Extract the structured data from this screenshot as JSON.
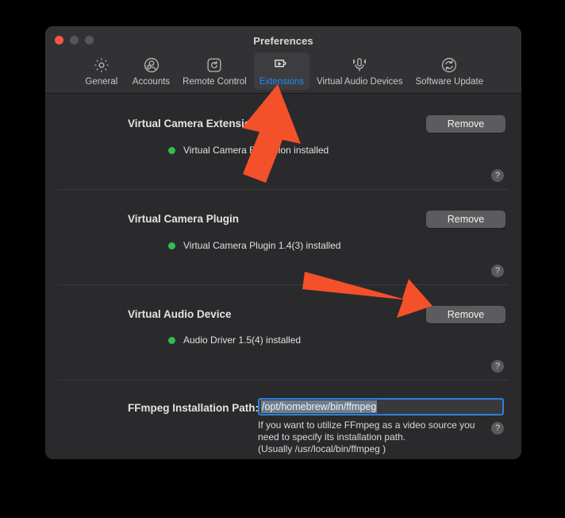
{
  "window": {
    "title": "Preferences",
    "traffic_lights": [
      "close",
      "minimize",
      "maximize"
    ]
  },
  "toolbar": {
    "items": [
      {
        "label": "General",
        "icon": "gear-icon",
        "active": false
      },
      {
        "label": "Accounts",
        "icon": "user-account-icon",
        "active": false
      },
      {
        "label": "Remote Control",
        "icon": "remote-control-icon",
        "active": false
      },
      {
        "label": "Extensions",
        "icon": "puzzle-play-icon",
        "active": true
      },
      {
        "label": "Virtual Audio Devices",
        "icon": "microphone-icon",
        "active": false
      },
      {
        "label": "Software Update",
        "icon": "refresh-circle-icon",
        "active": false
      }
    ]
  },
  "sections": [
    {
      "title": "Virtual Camera Extension",
      "status": "Virtual Camera Extension installed",
      "status_color": "#2fc04a",
      "button": "Remove",
      "help": "?"
    },
    {
      "title": "Virtual Camera Plugin",
      "status": "Virtual Camera Plugin 1.4(3) installed",
      "status_color": "#2fc04a",
      "button": "Remove",
      "help": "?"
    },
    {
      "title": "Virtual Audio Device",
      "status": "Audio Driver 1.5(4) installed",
      "status_color": "#2fc04a",
      "button": "Remove",
      "help": "?"
    }
  ],
  "ffmpeg": {
    "label": "FFmpeg Installation Path:",
    "value": "/opt/homebrew/bin/ffmpeg",
    "placeholder": "/usr/local/bin/ffmpeg",
    "help_line_1": "If you want to utilize FFmpeg as a video source you",
    "help_line_2": "need to specify its installation path.",
    "help_line_3": "(Usually /usr/local/bin/ffmpeg )",
    "help": "?"
  },
  "annotations": {
    "color": "#f4502a",
    "arrow_1": "arrow-pointing-to-extensions-tab",
    "arrow_2": "arrow-pointing-to-virtual-audio-device-remove-button"
  },
  "colors": {
    "accent_blue": "#1d8cf8",
    "window_bg": "#2a2a2c",
    "toolbar_bg": "#323234",
    "button_grey": "#5c5c5e",
    "status_green": "#2fc04a",
    "annotation_orange": "#f4502a",
    "desktop_bg": "#000000"
  }
}
